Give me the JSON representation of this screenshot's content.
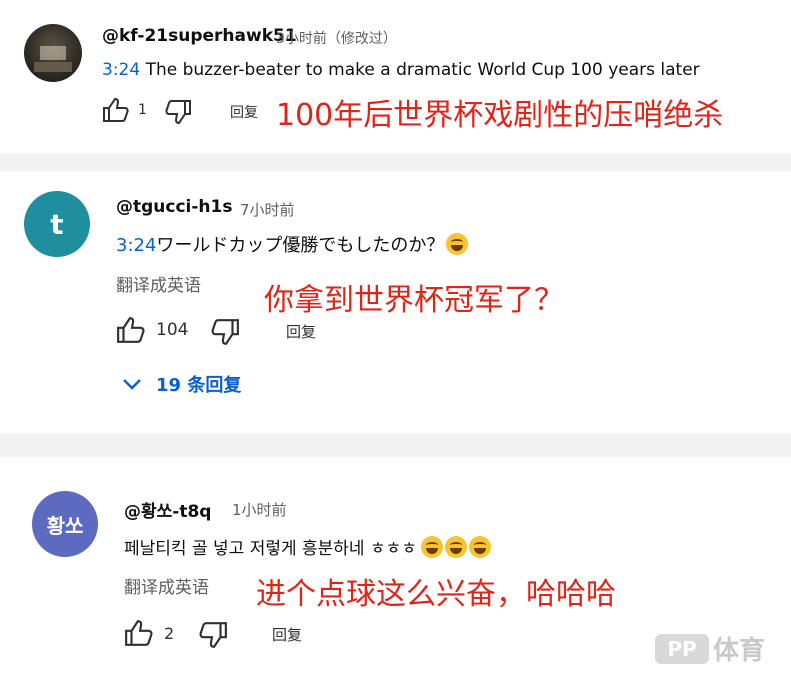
{
  "comments": [
    {
      "handle": "@kf-21superhawk51",
      "time": "3小时前（修改过）",
      "timestamp_link": "3:24",
      "text": "The buzzer-beater to make a dramatic World Cup 100 years later",
      "likes": "1",
      "reply_label": "回复",
      "overlay_translation": "100年后世界杯戏剧性的压哨绝杀"
    },
    {
      "avatar_letter": "t",
      "avatar_color": "#1f8fa0",
      "handle": "@tgucci-h1s",
      "time": "7小时前",
      "timestamp_link": "3:24",
      "text": "ワールドカップ優勝でもしたのか？",
      "translate_label": "翻译成英语",
      "overlay_translation": "你拿到世界杯冠军了？",
      "likes": "104",
      "reply_label": "回复",
      "replies_label": "19 条回复"
    },
    {
      "avatar_letter": "황쏘",
      "avatar_color": "#5c6bc0",
      "handle": "@황쏘-t8q",
      "time": "1小时前",
      "text": "페날티킥 골 넣고 저렇게 흥분하네 ㅎㅎㅎ",
      "translate_label": "翻译成英语",
      "overlay_translation": "进个点球这么兴奋，哈哈哈",
      "likes": "2",
      "reply_label": "回复"
    }
  ],
  "watermark": {
    "mark": "PP",
    "label": "体育"
  },
  "colors": {
    "link_blue": "#065fd4",
    "overlay_red": "#e02418",
    "muted_gray": "#606060",
    "separator": "#f2f2f2"
  }
}
